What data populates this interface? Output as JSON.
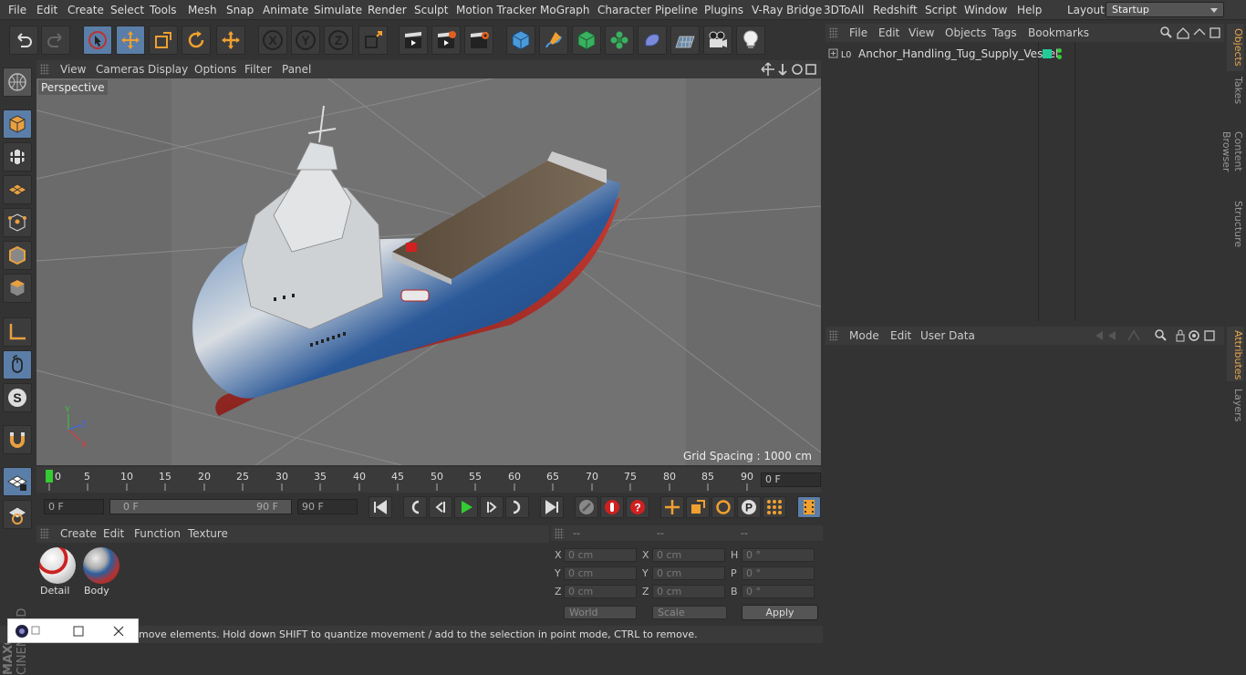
{
  "menu": [
    "File",
    "Edit",
    "Create",
    "Select",
    "Tools",
    "Mesh",
    "Snap",
    "Animate",
    "Simulate",
    "Render",
    "Sculpt",
    "Motion Tracker",
    "MoGraph",
    "Character",
    "Pipeline",
    "Plugins",
    "V-Ray Bridge",
    "3DToAll",
    "Redshift",
    "Script",
    "Window",
    "Help"
  ],
  "layout": {
    "label": "Layout:",
    "value": "Startup"
  },
  "viewport": {
    "menu": [
      "View",
      "Cameras",
      "Display",
      "Options",
      "Filter",
      "Panel"
    ],
    "label": "Perspective",
    "grid_spacing": "Grid Spacing : 1000 cm"
  },
  "timeline": {
    "ticks": [
      "0",
      "5",
      "10",
      "15",
      "20",
      "25",
      "30",
      "35",
      "40",
      "45",
      "50",
      "55",
      "60",
      "65",
      "70",
      "75",
      "80",
      "85",
      "90"
    ],
    "current_frame": "0 F"
  },
  "transport": {
    "start": "0 F",
    "range_start": "0 F",
    "range_end": "90 F",
    "end": "90 F"
  },
  "materials": {
    "menu": [
      "Create",
      "Edit",
      "Function",
      "Texture"
    ],
    "items": [
      "Detail",
      "Body"
    ]
  },
  "coords": {
    "headers": [
      "--",
      "--",
      "--"
    ],
    "rows": [
      [
        "X",
        "0 cm",
        "X",
        "0 cm",
        "H",
        "0 °"
      ],
      [
        "Y",
        "0 cm",
        "Y",
        "0 cm",
        "P",
        "0 °"
      ],
      [
        "Z",
        "0 cm",
        "Z",
        "0 cm",
        "B",
        "0 °"
      ]
    ],
    "mode": "World",
    "type": "Scale",
    "apply": "Apply"
  },
  "objects": {
    "menu": [
      "File",
      "Edit",
      "View",
      "Objects",
      "Tags",
      "Bookmarks"
    ],
    "item": "Anchor_Handling_Tug_Supply_Vessel"
  },
  "attributes": {
    "menu": [
      "Mode",
      "Edit",
      "User Data"
    ]
  },
  "sidetabs": [
    "Objects",
    "Takes",
    "Content Browser",
    "Structure",
    "Attributes",
    "Layers"
  ],
  "status": "move elements. Hold down SHIFT to quantize movement / add to the selection in point mode, CTRL to remove.",
  "logo": {
    "brand": "MAXON",
    "product": "CINEMA 4D"
  },
  "colors": {
    "accent": "#5a7ea8",
    "tab_active": "#e8a84c",
    "hull_blue": "#2d5f9e",
    "hull_red": "#b8302c"
  }
}
